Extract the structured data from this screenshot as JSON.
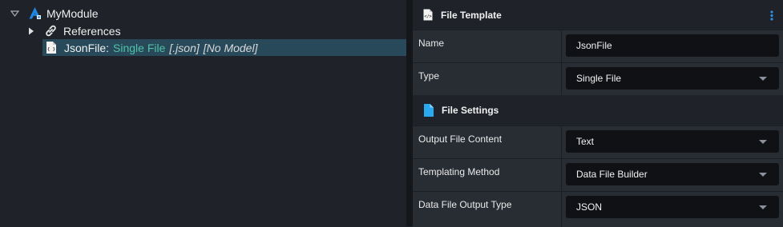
{
  "tree": {
    "root": {
      "label": "MyModule",
      "icon": "module-icon",
      "expanded": true
    },
    "references": {
      "label": "References",
      "icon": "link-icon",
      "expanded": false
    },
    "file": {
      "name": "JsonFile:",
      "type": "Single File",
      "extension": "[.json]",
      "model": "[No Model]",
      "icon": "json-file-icon",
      "selected": true
    }
  },
  "sections": {
    "file_template": {
      "title": "File Template",
      "icon": "file-template-icon",
      "menu_icon": "more-options-icon"
    },
    "file_settings": {
      "title": "File Settings",
      "icon": "file-icon"
    }
  },
  "properties": {
    "name": {
      "label": "Name",
      "value": "JsonFile"
    },
    "type": {
      "label": "Type",
      "value": "Single File"
    },
    "output_file_content": {
      "label": "Output File Content",
      "value": "Text"
    },
    "templating_method": {
      "label": "Templating Method",
      "value": "Data File Builder"
    },
    "data_file_output_type": {
      "label": "Data File Output Type",
      "value": "JSON"
    }
  },
  "colors": {
    "accent_teal": "#4fc2a8",
    "selection": "#27495a",
    "module_blue": "#1e88e5",
    "file_blue": "#29a9f0",
    "menu_blue": "#2f8ee3"
  }
}
